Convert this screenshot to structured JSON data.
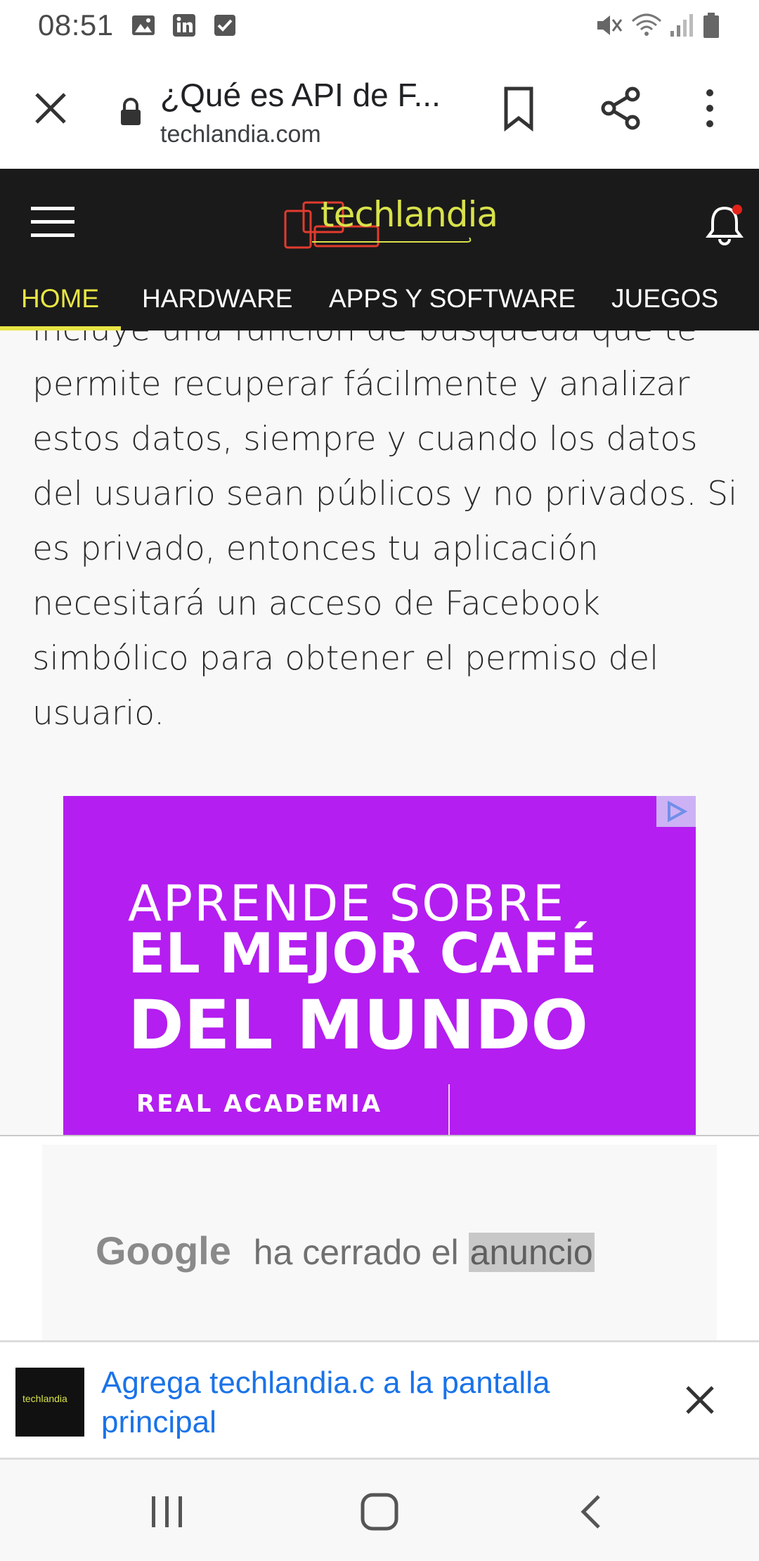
{
  "status_bar": {
    "time": "08:51",
    "icons": [
      "gallery-icon",
      "linkedin-icon",
      "checkbox-icon",
      "mute-icon",
      "wifi-icon",
      "signal-icon",
      "battery-icon"
    ]
  },
  "toolbar": {
    "title": "¿Qué es API de F...",
    "domain": "techlandia.com"
  },
  "site": {
    "logo_text": "techlandia",
    "nav": [
      {
        "label": "HOME",
        "active": true
      },
      {
        "label": "HARDWARE",
        "active": false
      },
      {
        "label": "APPS Y SOFTWARE",
        "active": false
      },
      {
        "label": "JUEGOS",
        "active": false
      }
    ]
  },
  "article": {
    "text": "incluye una función de búsqueda que te permite recuperar fácilmente y analizar estos datos, siempre y cuando los datos del usuario sean públicos y no privados. Si es privado, entonces tu aplicación necesitará un acceso de Facebook simbólico para obtener el permiso del usuario."
  },
  "ad": {
    "line1": "APRENDE SOBRE",
    "line2": "EL MEJOR CAFÉ",
    "line3": "DEL MUNDO",
    "line4": "REAL ACADEMIA"
  },
  "closed_ad": {
    "brand": "Google",
    "text": "ha cerrado el",
    "highlight": "anuncio"
  },
  "home_banner": {
    "icon_text": "techlandia",
    "text": "Agrega techlandia.c a la pantalla principal"
  },
  "colors": {
    "header_bg": "#1a1a1a",
    "nav_active": "#e8e545",
    "ad_bg": "#b41ef0",
    "link_blue": "#1a73e8"
  }
}
